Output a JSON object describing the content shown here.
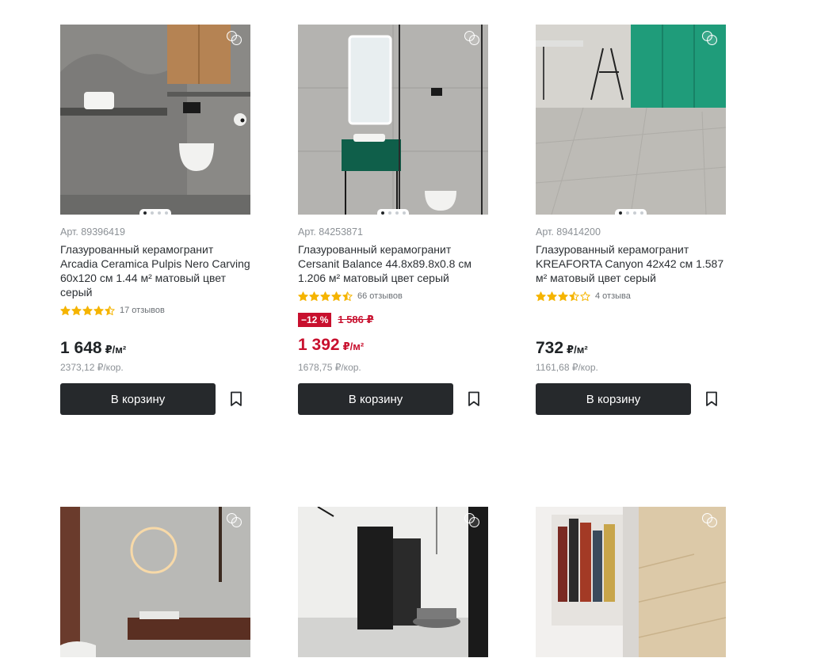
{
  "colors": {
    "accent": "#c8102e",
    "button": "#26292c",
    "star": "#f5b400"
  },
  "products": [
    {
      "article": "Арт. 89396419",
      "title": "Глазурованный керамогранит Arcadia Ceramica Pulpis Nero Carving 60x120 см 1.44 м² матовый цвет серый",
      "rating": 4.5,
      "reviews": "17 отзывов",
      "price": "1 648",
      "price_unit": "₽/м²",
      "box_price": "2373,12 ₽/кор.",
      "cart_label": "В корзину"
    },
    {
      "article": "Арт. 84253871",
      "title": "Глазурованный керамогранит Cersanit Balance 44.8x89.8x0.8 см 1.206 м² матовый цвет серый",
      "rating": 4.5,
      "reviews": "66 отзывов",
      "discount": "−12 %",
      "old_price": "1 586 ₽",
      "price": "1 392",
      "price_unit": "₽/м²",
      "box_price": "1678,75 ₽/кор.",
      "cart_label": "В корзину"
    },
    {
      "article": "Арт. 89414200",
      "title": "Глазурованный керамогранит KREAFORTA Canyon 42x42 см 1.587 м² матовый цвет серый",
      "rating": 3.5,
      "reviews": "4 отзыва",
      "price": "732",
      "price_unit": "₽/м²",
      "box_price": "1161,68 ₽/кор.",
      "cart_label": "В корзину"
    }
  ]
}
